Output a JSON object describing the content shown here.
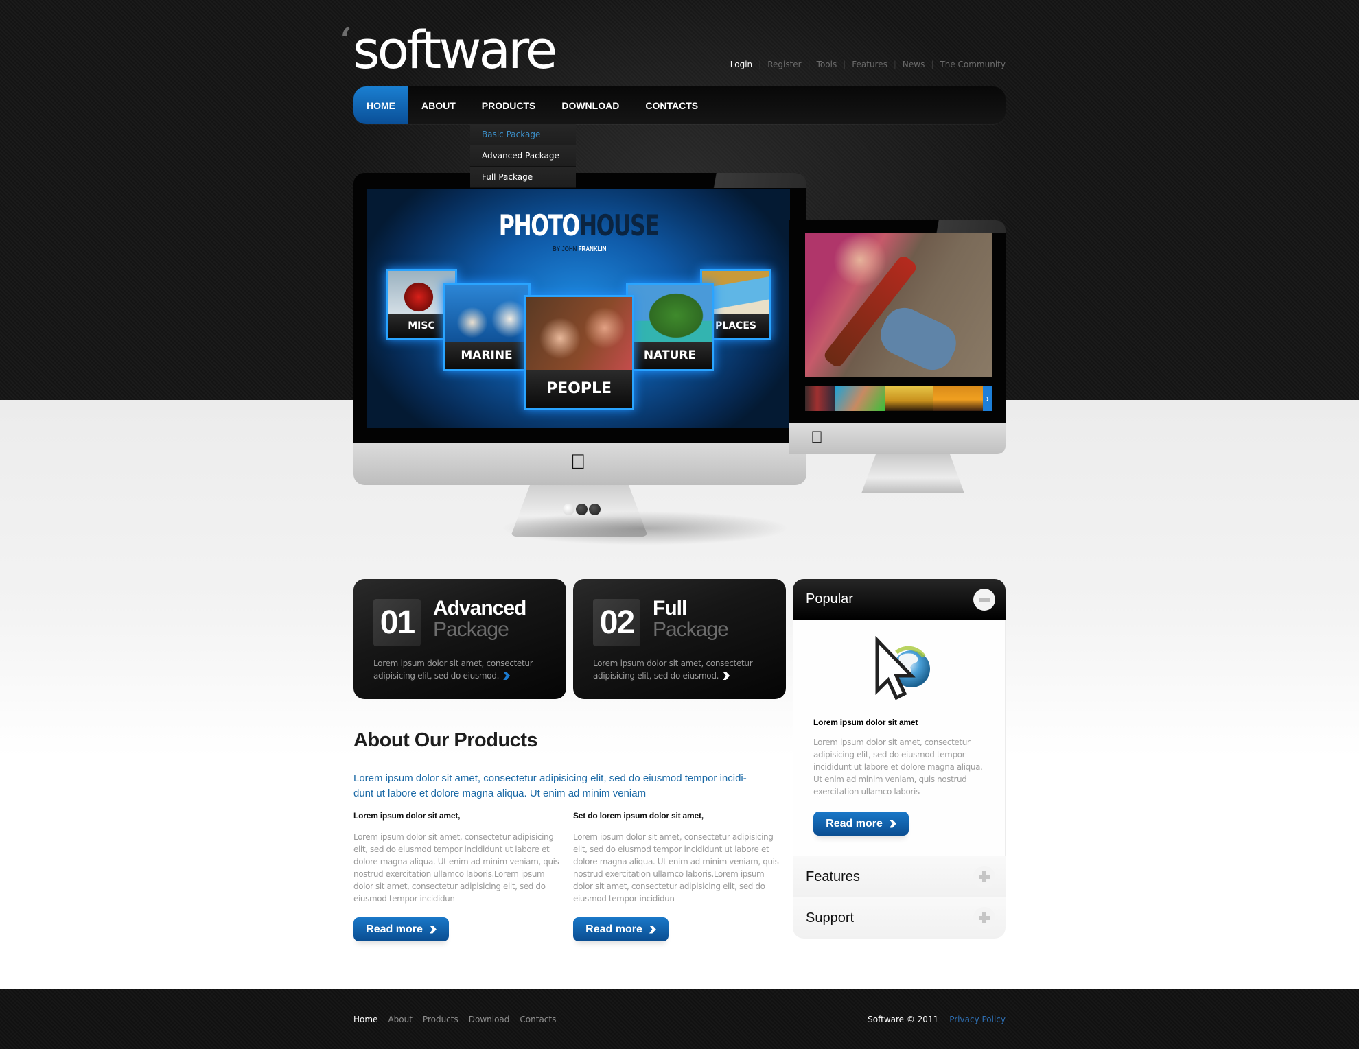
{
  "logo": {
    "quote": "‘",
    "text": "software"
  },
  "top_links": [
    {
      "label": "Login",
      "active": true
    },
    {
      "label": "Register"
    },
    {
      "label": "Tools"
    },
    {
      "label": "Features"
    },
    {
      "label": "News"
    },
    {
      "label": "The Community"
    }
  ],
  "nav": {
    "items": [
      {
        "label": "HOME",
        "active": true
      },
      {
        "label": "ABOUT"
      },
      {
        "label": "PRODUCTS"
      },
      {
        "label": "DOWNLOAD"
      },
      {
        "label": "CONTACTS"
      }
    ],
    "products_dropdown": [
      {
        "label": "Basic Package",
        "highlighted": true
      },
      {
        "label": "Advanced Package"
      },
      {
        "label": "Full Package"
      }
    ]
  },
  "slider": {
    "screen": {
      "title_white": "PHOTO",
      "title_dark": "HOUSE",
      "byline_dark": "BY JOHN",
      "byline_white": "FRANKLIN",
      "tiles": [
        "MISC",
        "MARINE",
        "PEOPLE",
        "NATURE",
        "PLACES"
      ]
    },
    "next_arrow": "›",
    "pagination": {
      "total": 3,
      "active": 1
    }
  },
  "packages": [
    {
      "number": "01",
      "title": "Advanced",
      "subtitle": "Package",
      "description": "Lorem ipsum dolor sit amet, consectetur adipisicing elit, sed do eiusmod.",
      "arrow": "blue"
    },
    {
      "number": "02",
      "title": "Full",
      "subtitle": "Package",
      "description": "Lorem ipsum dolor sit amet, consectetur adipisicing elit, sed do eiusmod.",
      "arrow": "white"
    }
  ],
  "about": {
    "title": "About Our Products",
    "lead": "Lorem ipsum dolor sit amet, consectetur adipisicing elit, sed do eiusmod tempor incidi-dunt ut labore et dolore magna aliqua. Ut enim ad minim veniam",
    "columns": [
      {
        "heading": "Lorem ipsum dolor sit amet,",
        "body": "Lorem ipsum dolor sit amet, consectetur adipisicing elit, sed do eiusmod tempor incididunt ut labore et dolore magna aliqua. Ut enim ad minim veniam, quis nostrud exercitation ullamco laboris.Lorem ipsum dolor sit amet, consectetur adipisicing elit, sed do eiusmod tempor incididun",
        "button": "Read more"
      },
      {
        "heading": "Set do lorem ipsum dolor sit amet,",
        "body": "Lorem ipsum dolor sit amet, consectetur adipisicing elit, sed do eiusmod tempor incididunt ut labore et dolore magna aliqua. Ut enim ad minim veniam, quis nostrud exercitation ullamco laboris.Lorem ipsum dolor sit amet, consectetur adipisicing elit, sed do eiusmod tempor incididun",
        "button": "Read more"
      }
    ]
  },
  "sidebar": {
    "popular": {
      "title": "Popular",
      "icon": "cursor-globe-icon",
      "heading": "Lorem ipsum dolor sit amet",
      "body": "Lorem ipsum dolor sit amet, consectetur adipisicing elit, sed do eiusmod tempor incididunt ut labore et dolore magna aliqua. Ut enim ad minim veniam, quis nostrud exercitation ullamco laboris",
      "button": "Read more",
      "expanded": true
    },
    "sections": [
      {
        "title": "Features",
        "expanded": false
      },
      {
        "title": "Support",
        "expanded": false
      }
    ]
  },
  "footer": {
    "links": [
      {
        "label": "Home",
        "active": true
      },
      {
        "label": "About"
      },
      {
        "label": "Products"
      },
      {
        "label": "Download"
      },
      {
        "label": "Contacts"
      }
    ],
    "copyright": "Software © 2011",
    "privacy": "Privacy Policy"
  },
  "colors": {
    "accent_blue": "#0a5aa8",
    "dropdown_highlight": "#3c8fc8",
    "lead_text": "#1c6aa6",
    "privacy_link": "#2e6fb3"
  }
}
